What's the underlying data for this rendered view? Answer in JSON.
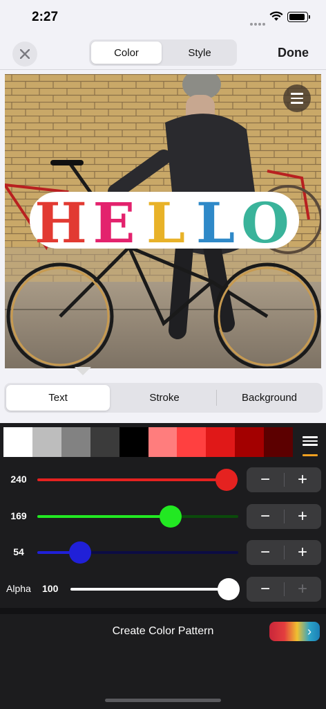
{
  "status_bar": {
    "time": "2:27"
  },
  "nav": {
    "tabs": [
      {
        "label": "Color",
        "active": true
      },
      {
        "label": "Style",
        "active": false
      }
    ],
    "done_label": "Done"
  },
  "canvas": {
    "sticker_text": "HELLO",
    "letter_colors": [
      "#e23a32",
      "#e3226d",
      "#e8b228",
      "#2f89c8",
      "#3ab39a"
    ]
  },
  "sub_tabs": [
    {
      "label": "Text",
      "active": true
    },
    {
      "label": "Stroke",
      "active": false
    },
    {
      "label": "Background",
      "active": false
    }
  ],
  "swatches": [
    "#ffffff",
    "#bdbdbd",
    "#828282",
    "#3b3b3b",
    "#000000",
    "#ff7d7d",
    "#ff4040",
    "#e01818",
    "#a30000",
    "#5c0000"
  ],
  "sliders": {
    "red": {
      "label": "240",
      "value": 240,
      "max": 255,
      "color": "#e52220",
      "track_rest": "#4a1010"
    },
    "green": {
      "label": "169",
      "value": 169,
      "max": 255,
      "color": "#22e822",
      "track_rest": "#0b4a0b"
    },
    "blue": {
      "label": "54",
      "value": 54,
      "max": 255,
      "color": "#2020d8",
      "track_rest": "#0c0c44"
    },
    "alpha": {
      "label": "Alpha",
      "value_label": "100",
      "value": 100,
      "max": 100,
      "color": "#ffffff"
    }
  },
  "stepper": {
    "minus": "−",
    "plus": "+"
  },
  "pattern": {
    "label": "Create Color Pattern"
  }
}
